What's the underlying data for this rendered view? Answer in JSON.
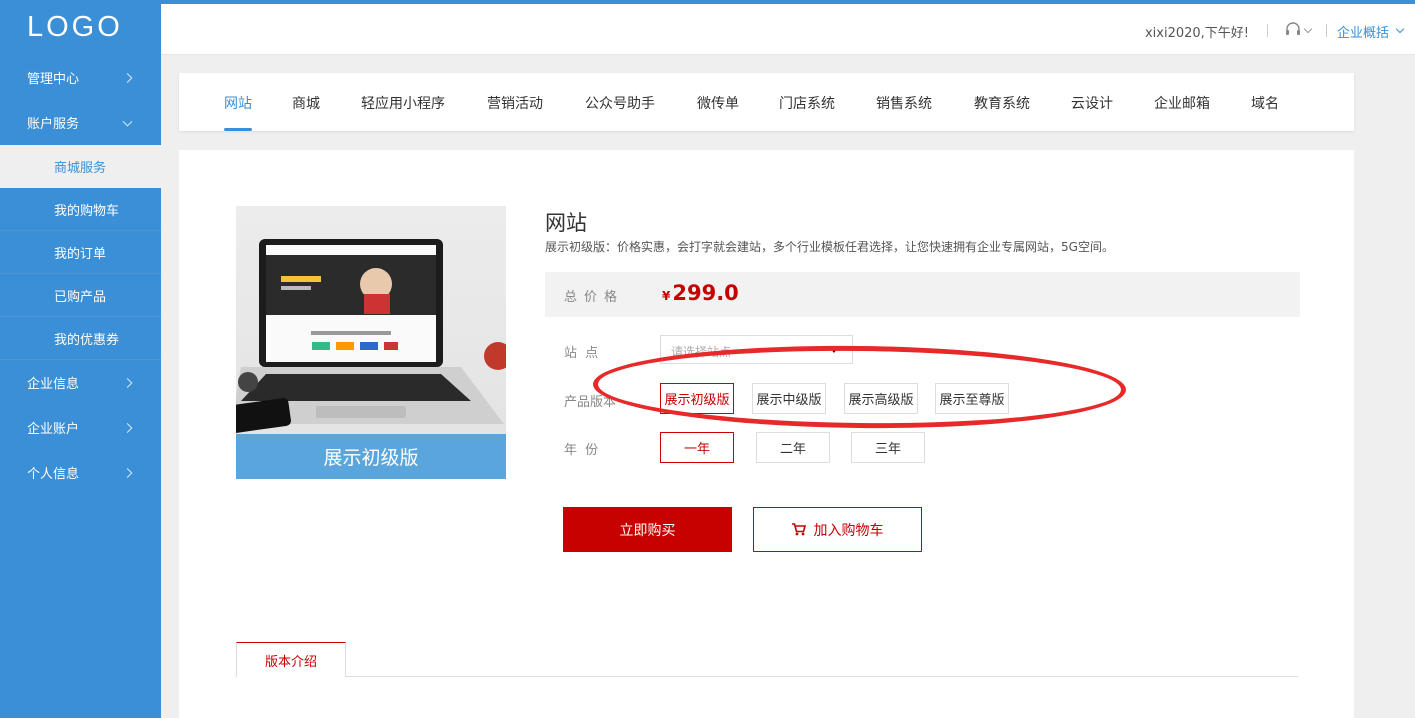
{
  "sidebar": {
    "logo": "LOGO",
    "items": [
      {
        "label": "管理中心"
      },
      {
        "label": "账户服务"
      },
      {
        "label": "企业信息"
      },
      {
        "label": "企业账户"
      },
      {
        "label": "个人信息"
      }
    ],
    "sub_items": [
      {
        "label": "商城服务",
        "active": true
      },
      {
        "label": "我的购物车"
      },
      {
        "label": "我的订单"
      },
      {
        "label": "已购产品"
      },
      {
        "label": "我的优惠券"
      }
    ]
  },
  "topbar": {
    "greeting": "xixi2020,下午好!",
    "overview": "企业概括",
    "icons": [
      "headset-icon",
      "chevron-down-icon"
    ]
  },
  "catnav": {
    "tabs": [
      {
        "label": "网站",
        "active": true
      },
      {
        "label": "商城"
      },
      {
        "label": "轻应用小程序"
      },
      {
        "label": "营销活动"
      },
      {
        "label": "公众号助手"
      },
      {
        "label": "微传单"
      },
      {
        "label": "门店系统"
      },
      {
        "label": "销售系统"
      },
      {
        "label": "教育系统"
      },
      {
        "label": "云设计"
      },
      {
        "label": "企业邮箱"
      },
      {
        "label": "域名"
      }
    ]
  },
  "product": {
    "image_caption": "展示初级版",
    "title": "网站",
    "description": "展示初级版：价格实惠，会打字就会建站，多个行业模板任君选择，让您快速拥有企业专属网站，5G空间。",
    "price_label": "总价格",
    "currency": "¥",
    "price": "299.0",
    "site_label": "站 点",
    "site_placeholder": "请选择站点",
    "version_label": "产品版本",
    "versions": [
      "展示初级版",
      "展示中级版",
      "展示高级版",
      "展示至尊版"
    ],
    "year_label": "年 份",
    "years": [
      "一年",
      "二年",
      "三年"
    ],
    "buy_now": "立即购买",
    "add_to_cart": "加入购物车",
    "intro_tab": "版本介绍"
  },
  "colors": {
    "sidebar": "#3a8fd6",
    "accent_red": "#c70000",
    "annotation": "#e8292a"
  }
}
